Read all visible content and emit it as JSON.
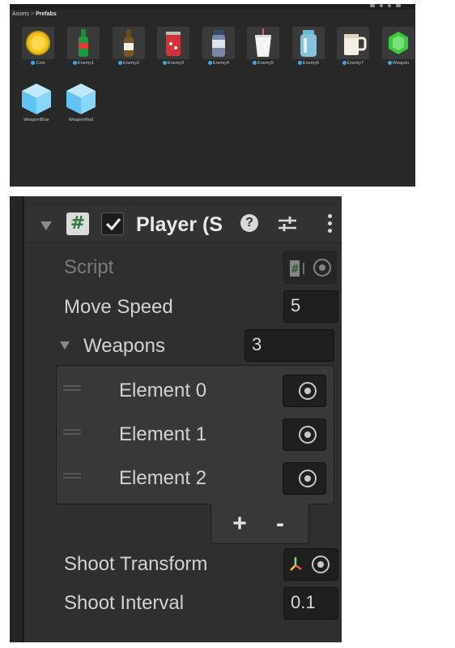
{
  "project": {
    "breadcrumb": {
      "root": "Assets",
      "separator": ">",
      "current": "Prefabs"
    },
    "assets": [
      {
        "label": "Coin",
        "icon": "coin-icon"
      },
      {
        "label": "Enemy1",
        "icon": "green-bottle-icon"
      },
      {
        "label": "Enemy2",
        "icon": "brown-bottle-icon"
      },
      {
        "label": "Enemy3",
        "icon": "red-can-icon"
      },
      {
        "label": "Enemy4",
        "icon": "thermos-icon"
      },
      {
        "label": "Enemy5",
        "icon": "cup-icon"
      },
      {
        "label": "Enemy6",
        "icon": "jar-icon"
      },
      {
        "label": "Enemy7",
        "icon": "mug-icon"
      },
      {
        "label": "Weapon",
        "icon": "green-gem-icon"
      },
      {
        "label": "WeaponBlue",
        "icon": "blue-cube-icon"
      },
      {
        "label": "WeaponRed",
        "icon": "blue-cube-icon"
      }
    ]
  },
  "inspector": {
    "component_title": "Player (S",
    "script_label": "Script",
    "move_speed": {
      "label": "Move Speed",
      "value": "5"
    },
    "weapons": {
      "label": "Weapons",
      "count": "3",
      "elements": [
        "Element 0",
        "Element 1",
        "Element 2"
      ],
      "add_label": "+",
      "remove_label": "-"
    },
    "shoot_transform": {
      "label": "Shoot Transform"
    },
    "shoot_interval": {
      "label": "Shoot Interval",
      "value": "0.1"
    }
  },
  "colors": {
    "background": "#282828",
    "panel": "#2f2f2f",
    "field": "#1f1f1f",
    "prefab_badge": "#3fa7e6",
    "script_hash": "#2b7a3b"
  }
}
